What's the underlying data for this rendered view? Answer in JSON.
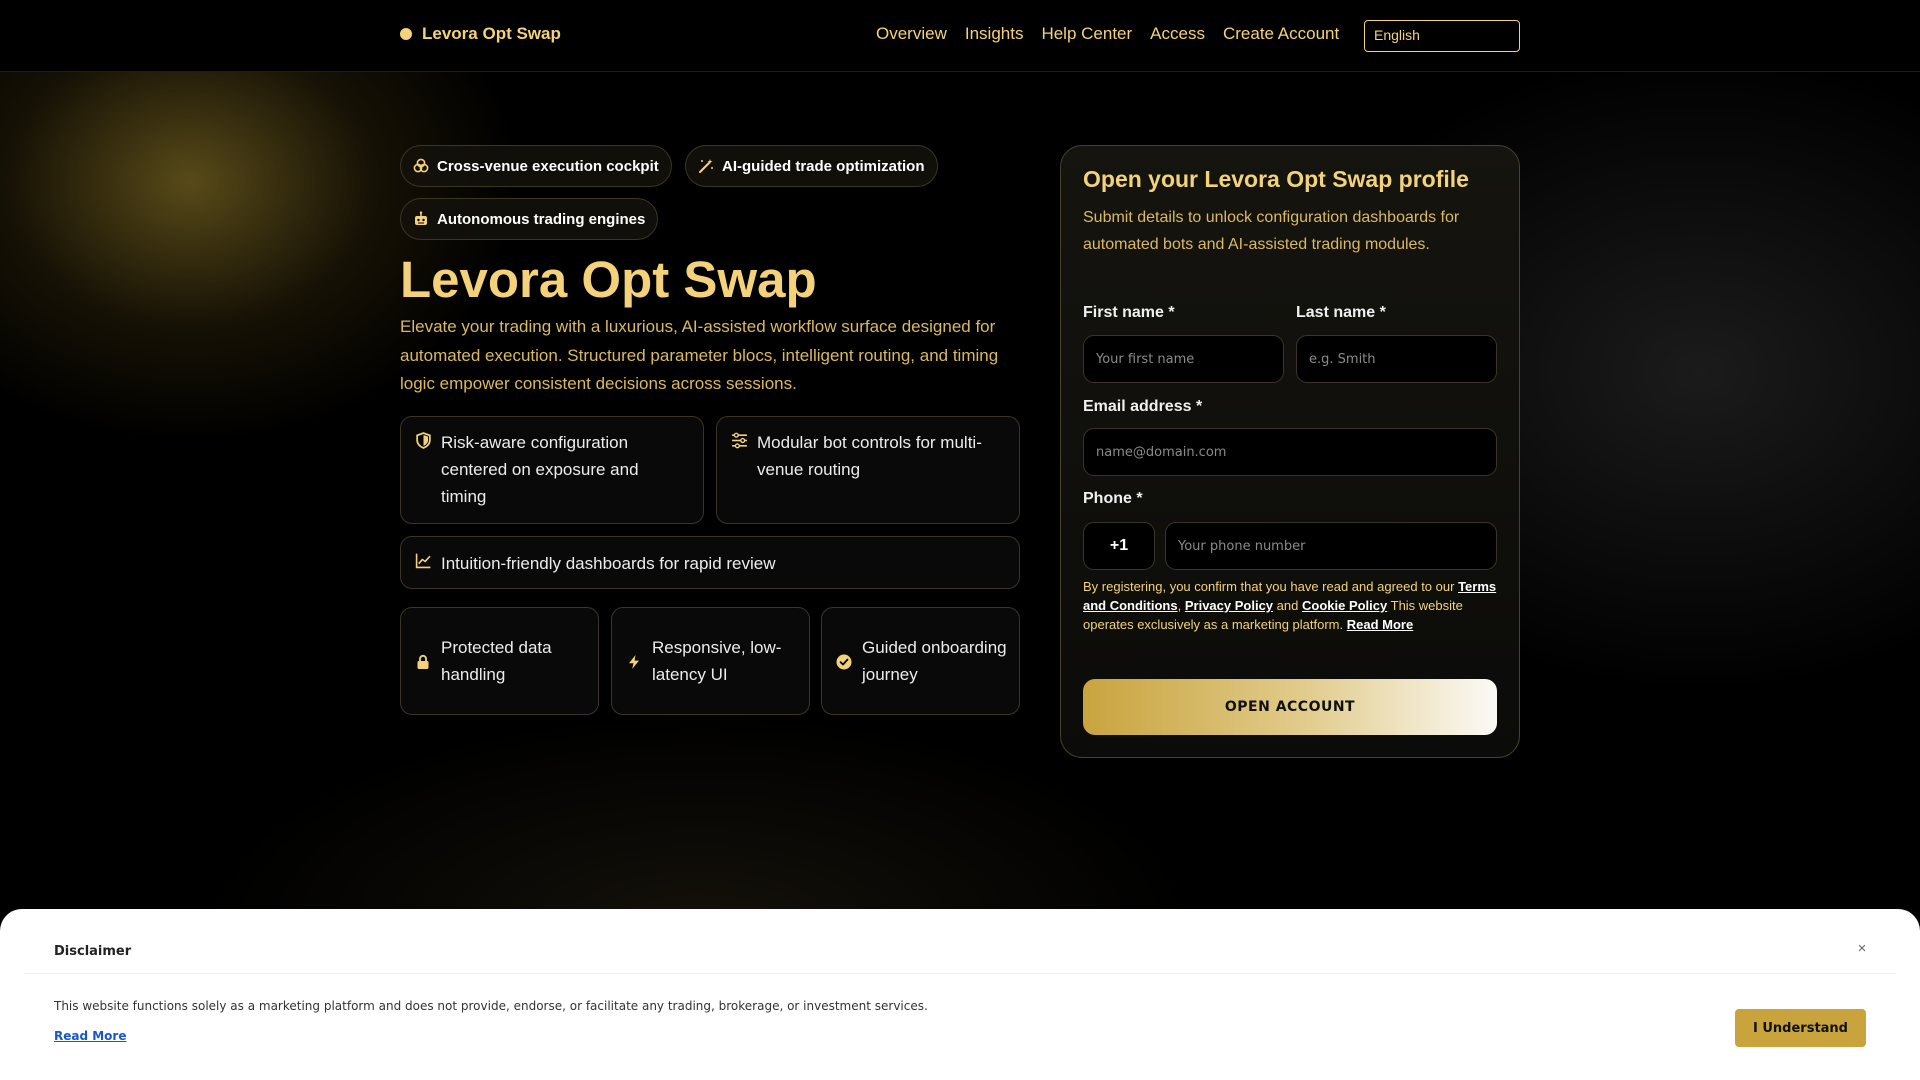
{
  "colors": {
    "accent": "#f3d27a",
    "background": "#000000",
    "button_gold": "#c9a43d",
    "link_blue": "#1a56c8"
  },
  "nav": {
    "brand": "Levora Opt Swap",
    "links": [
      "Overview",
      "Insights",
      "Help Center",
      "Access",
      "Create Account"
    ],
    "language": "English"
  },
  "hero": {
    "chips": [
      {
        "label": "Cross-venue execution cockpit",
        "icon": "coins-icon"
      },
      {
        "label": "AI-guided trade optimization",
        "icon": "magic-wand-icon"
      },
      {
        "label": "Autonomous trading engines",
        "icon": "robot-icon"
      }
    ],
    "title": "Levora Opt Swap",
    "description": "Elevate your trading with a luxurious, AI-assisted workflow surface designed for automated execution. Structured parameter blocs, intelligent routing, and timing logic empower consistent decisions across sessions.",
    "features": [
      {
        "text": "Risk-aware configuration centered on exposure and timing",
        "icon": "shield-icon"
      },
      {
        "text": "Modular bot controls for multi-venue routing",
        "icon": "sliders-icon"
      },
      {
        "text": "Intuition-friendly dashboards for rapid review",
        "icon": "line-chart-icon"
      }
    ],
    "badges": [
      {
        "text": "Protected data handling",
        "icon": "lock-icon"
      },
      {
        "text": "Responsive, low-latency UI",
        "icon": "bolt-icon"
      },
      {
        "text": "Guided onboarding journey",
        "icon": "check-circle-icon"
      }
    ]
  },
  "form": {
    "title": "Open your Levora Opt Swap profile",
    "subtitle": "Submit details to unlock configuration dashboards for automated bots and AI-assisted trading modules.",
    "first_name_label": "First name *",
    "first_name_placeholder": "Your first name",
    "last_name_label": "Last name *",
    "last_name_placeholder": "e.g. Smith",
    "email_label": "Email address *",
    "email_placeholder": "name@domain.com",
    "phone_label": "Phone *",
    "phone_prefix": "+1",
    "phone_placeholder": "Your phone number",
    "consent_intro": "By registering, you confirm that you have read and agreed to our",
    "terms_link": "Terms and Conditions",
    "comma": ",",
    "privacy_link": "Privacy Policy",
    "and": "and",
    "cookie_link": "Cookie Policy",
    "consent_note": "This website operates exclusively as a marketing platform.",
    "read_more": "Read More",
    "submit_label": "OPEN ACCOUNT"
  },
  "disclaimer": {
    "title": "Disclaimer",
    "close": "×",
    "text": "This website functions solely as a marketing platform and does not provide, endorse, or facilitate any trading, brokerage, or investment services.",
    "read_more": "Read More",
    "button": "I Understand"
  }
}
